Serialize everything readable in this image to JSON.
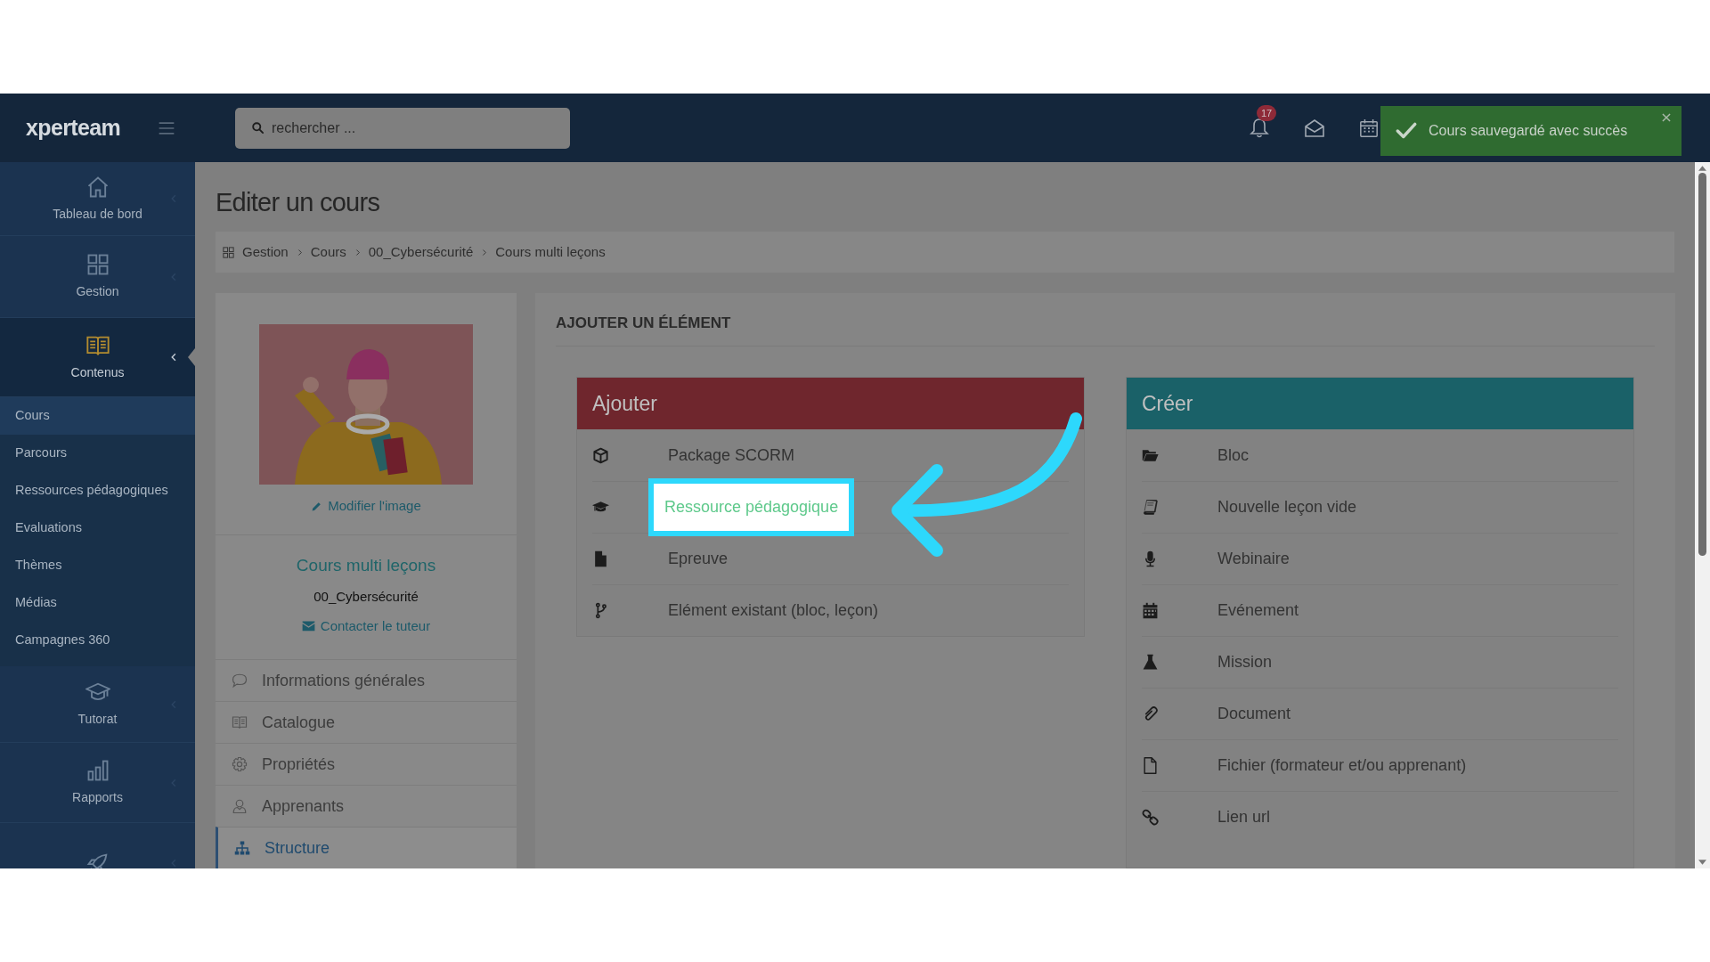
{
  "topbar": {
    "logo": "xperteam",
    "search": {
      "placeholder": "rechercher ..."
    },
    "notifications": {
      "count": "17"
    },
    "toast": {
      "message": "Cours sauvegardé avec succès"
    }
  },
  "sidebar": {
    "sections": [
      {
        "label": "Tableau de bord",
        "selected": false
      },
      {
        "label": "Gestion",
        "selected": false
      },
      {
        "label": "Contenus",
        "selected": true,
        "children": [
          {
            "label": "Cours",
            "selected": true
          },
          {
            "label": "Parcours",
            "selected": false
          },
          {
            "label": "Ressources pédagogiques",
            "selected": false
          },
          {
            "label": "Evaluations",
            "selected": false
          },
          {
            "label": "Thèmes",
            "selected": false
          },
          {
            "label": "Médias",
            "selected": false
          },
          {
            "label": "Campagnes 360",
            "selected": false
          }
        ]
      },
      {
        "label": "Tutorat",
        "selected": false
      },
      {
        "label": "Rapports",
        "selected": false
      },
      {
        "selected": false
      }
    ]
  },
  "page": {
    "title": "Editer un cours",
    "breadcrumb": [
      "Gestion",
      "Cours",
      "00_Cybersécurité",
      "Cours multi leçons"
    ]
  },
  "course_card": {
    "image_action": "Modifier l'image",
    "title": "Cours multi leçons",
    "category": "00_Cybersécurité",
    "contact": "Contacter le tuteur",
    "menu": [
      {
        "label": "Informations générales",
        "selected": false
      },
      {
        "label": "Catalogue",
        "selected": false
      },
      {
        "label": "Propriétés",
        "selected": false
      },
      {
        "label": "Apprenants",
        "selected": false
      },
      {
        "label": "Structure",
        "selected": true
      }
    ]
  },
  "add_panel": {
    "heading": "AJOUTER UN ÉLÉMENT",
    "add_card": {
      "title": "Ajouter",
      "items": [
        {
          "label": "Package SCORM",
          "highlighted": false
        },
        {
          "label": "Ressource pédagogique",
          "highlighted": true
        },
        {
          "label": "Epreuve",
          "highlighted": false
        },
        {
          "label": "Elément existant (bloc, leçon)",
          "highlighted": false
        }
      ]
    },
    "create_card": {
      "title": "Créer",
      "items": [
        {
          "label": "Bloc"
        },
        {
          "label": "Nouvelle leçon vide"
        },
        {
          "label": "Webinaire"
        },
        {
          "label": "Evénement"
        },
        {
          "label": "Mission"
        },
        {
          "label": "Document"
        },
        {
          "label": "Fichier (formateur et/ou apprenant)"
        },
        {
          "label": "Lien url"
        }
      ]
    }
  }
}
